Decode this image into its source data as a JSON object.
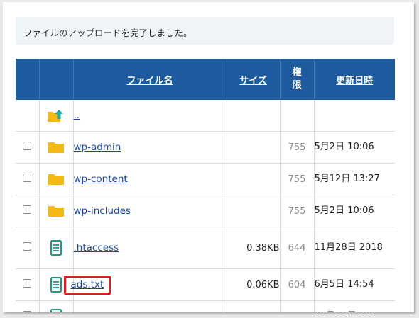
{
  "notice": "ファイルのアップロードを完了しました。",
  "columns": {
    "name": "ファイル名",
    "size": "サイズ",
    "permission": "権限",
    "modified": "更新日時"
  },
  "colors": {
    "header_bg": "#1d5a9e",
    "link": "#1a45a8",
    "folder": "#f5b914",
    "file_icon": "#1a9b80",
    "highlight": "#e8161b"
  },
  "rows": [
    {
      "icon": "folder-up-icon",
      "name": "..",
      "size": "",
      "permission": "",
      "modified": "",
      "checkbox": false
    },
    {
      "icon": "folder-icon",
      "name": "wp-admin",
      "size": "",
      "permission": "755",
      "modified": "5月2日 10:06",
      "checkbox": true
    },
    {
      "icon": "folder-icon",
      "name": "wp-content",
      "size": "",
      "permission": "755",
      "modified": "5月12日 13:27",
      "checkbox": true
    },
    {
      "icon": "folder-icon",
      "name": "wp-includes",
      "size": "",
      "permission": "755",
      "modified": "5月2日 10:06",
      "checkbox": true
    },
    {
      "icon": "file-icon",
      "name": ".htaccess",
      "size": "0.38KB",
      "permission": "644",
      "modified": "11月28日 2018",
      "checkbox": true
    },
    {
      "icon": "file-icon",
      "name": "ads.txt",
      "size": "0.06KB",
      "permission": "604",
      "modified": "6月5日 14:54",
      "checkbox": true,
      "highlighted": true
    },
    {
      "icon": "file-icon",
      "name": "",
      "size": "",
      "permission": "",
      "modified": "11月28日 201",
      "checkbox": true
    }
  ]
}
